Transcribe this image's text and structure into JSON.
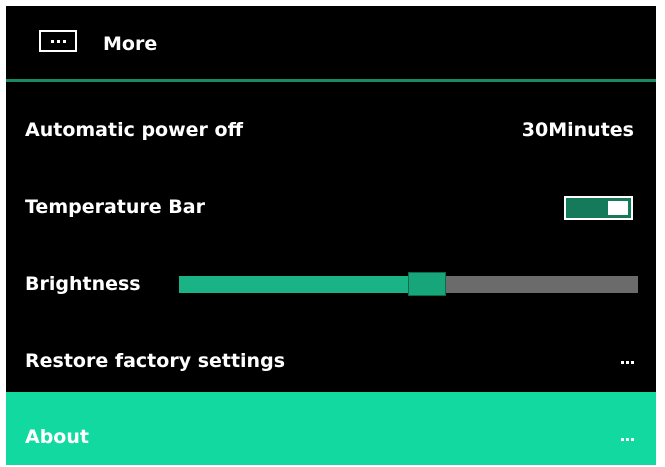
{
  "header": {
    "title": "More",
    "icon": "more-icon"
  },
  "settings": {
    "auto_power_off": {
      "label": "Automatic power off",
      "value": "30Minutes"
    },
    "temperature_bar": {
      "label": "Temperature Bar",
      "enabled": true
    },
    "brightness": {
      "label": "Brightness",
      "level_percent": 54
    },
    "restore_factory": {
      "label": "Restore factory settings",
      "icon": "ellipsis-icon"
    },
    "about": {
      "label": "About",
      "icon": "ellipsis-icon",
      "selected": true
    }
  },
  "colors": {
    "background": "#000000",
    "accent": "#12d9a0",
    "slider_fill": "#1ab386",
    "slider_rest": "#6b6b6b",
    "toggle_on": "#157a5a",
    "divider": "#1a8a66"
  }
}
